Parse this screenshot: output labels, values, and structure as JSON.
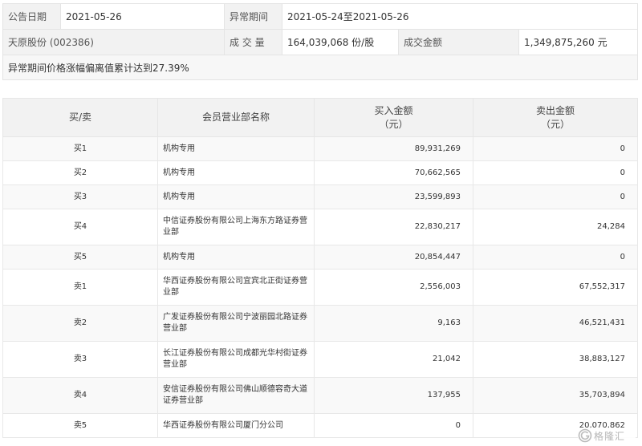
{
  "summary": {
    "date_label": "公告日期",
    "date_value": "2021-05-26",
    "period_label": "异常期间",
    "period_value": "2021-05-24至2021-05-26",
    "stock_name": "天原股份 (002386)",
    "volume_label": "成 交 量",
    "volume_value": "164,039,068 份/股",
    "amount_label": "成交金额",
    "amount_value": "1,349,875,260 元",
    "note": "异常期间价格涨幅偏离值累计达到27.39%"
  },
  "table": {
    "headers": {
      "side": "买/卖",
      "dept": "会员营业部名称",
      "buy_line1": "买入金额",
      "buy_line2": "（元）",
      "sell_line1": "卖出金额",
      "sell_line2": "（元）"
    },
    "rows": [
      {
        "side": "买1",
        "dept": "机构专用",
        "buy": "89,931,269",
        "sell": "0"
      },
      {
        "side": "买2",
        "dept": "机构专用",
        "buy": "70,662,565",
        "sell": "0"
      },
      {
        "side": "买3",
        "dept": "机构专用",
        "buy": "23,599,893",
        "sell": "0"
      },
      {
        "side": "买4",
        "dept": "中信证券股份有限公司上海东方路证券营业部",
        "buy": "22,830,217",
        "sell": "24,284"
      },
      {
        "side": "买5",
        "dept": "机构专用",
        "buy": "20,854,447",
        "sell": "0"
      },
      {
        "side": "卖1",
        "dept": "华西证券股份有限公司宜宾北正街证券营业部",
        "buy": "2,556,003",
        "sell": "67,552,317"
      },
      {
        "side": "卖2",
        "dept": "广发证券股份有限公司宁波丽园北路证券营业部",
        "buy": "9,163",
        "sell": "46,521,431"
      },
      {
        "side": "卖3",
        "dept": "长江证券股份有限公司成都光华村街证券营业部",
        "buy": "21,042",
        "sell": "38,883,127"
      },
      {
        "side": "卖4",
        "dept": "安信证券股份有限公司佛山顺德容奇大道证券营业部",
        "buy": "137,955",
        "sell": "35,703,894"
      },
      {
        "side": "卖5",
        "dept": "华西证券股份有限公司厦门分公司",
        "buy": "0",
        "sell": "20,070,862"
      }
    ]
  },
  "watermark": {
    "text": "格隆汇",
    "icon": "gelonghui-logo-icon"
  }
}
